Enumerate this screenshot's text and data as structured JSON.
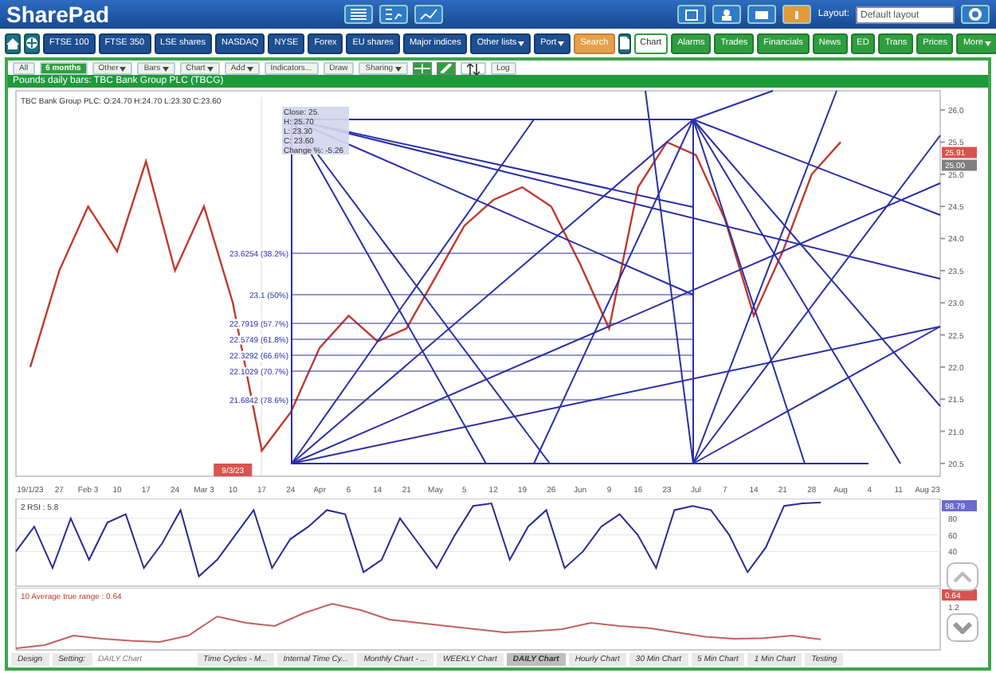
{
  "header": {
    "logo": "SharePad",
    "layout_label": "Layout:",
    "layout_value": "Default layout"
  },
  "nav": {
    "markets": [
      {
        "label": "FTSE 100",
        "dropdown": false
      },
      {
        "label": "FTSE 350",
        "dropdown": false
      },
      {
        "label": "LSE shares",
        "dropdown": false
      },
      {
        "label": "NASDAQ",
        "dropdown": false
      },
      {
        "label": "NYSE",
        "dropdown": false
      },
      {
        "label": "Forex",
        "dropdown": false
      },
      {
        "label": "EU shares",
        "dropdown": false
      },
      {
        "label": "Major indices",
        "dropdown": false
      },
      {
        "label": "Other lists",
        "dropdown": true
      },
      {
        "label": "Port",
        "dropdown": true
      }
    ],
    "search": "Search",
    "tools": [
      {
        "label": "Chart",
        "selected": true,
        "dropdown": false
      },
      {
        "label": "Alarms",
        "selected": false,
        "dropdown": false
      },
      {
        "label": "Trades",
        "selected": false,
        "dropdown": false
      },
      {
        "label": "Financials",
        "selected": false,
        "dropdown": false
      },
      {
        "label": "News",
        "selected": false,
        "dropdown": false
      },
      {
        "label": "ED",
        "selected": false,
        "dropdown": false
      },
      {
        "label": "Trans",
        "selected": false,
        "dropdown": false
      },
      {
        "label": "Prices",
        "selected": false,
        "dropdown": false
      },
      {
        "label": "More",
        "selected": false,
        "dropdown": true
      }
    ]
  },
  "toolbar": [
    {
      "label": "All",
      "selected": false,
      "dropdown": false
    },
    {
      "label": "6 months",
      "selected": true,
      "dropdown": false
    },
    {
      "label": "Other",
      "selected": false,
      "dropdown": true
    },
    {
      "label": "Bars",
      "selected": false,
      "dropdown": true
    },
    {
      "label": "Chart",
      "selected": false,
      "dropdown": true
    },
    {
      "label": "Add",
      "selected": false,
      "dropdown": true
    },
    {
      "label": "Indicators...",
      "selected": false,
      "dropdown": false
    },
    {
      "label": "Draw",
      "selected": false,
      "dropdown": false
    },
    {
      "label": "Sharing",
      "selected": false,
      "dropdown": true
    }
  ],
  "toolbar_log": "Log",
  "chart_title": "Pounds daily bars: TBC Bank Group PLC (TBCG)",
  "price_pane": {
    "legend": "TBC Bank Group PLC: O:24.70 H:24.70 L:23.30 C:23.60",
    "info_box": [
      "Close: 25.",
      "H: 25.70",
      "L: 23.30",
      "C: 23.60",
      "Change %: -5.26"
    ],
    "fib_labels": [
      "23.6254 (38.2%)",
      "23.1 (50%)",
      "22.7919 (57.7%)",
      "22.5749 (61.8%)",
      "22.3292 (66.6%)",
      "22.1029 (70.7%)",
      "21.6842 (78.6%)"
    ],
    "date_marker": "9/3/23",
    "price_badges": [
      {
        "text": "25.91",
        "color": "#d9534f"
      },
      {
        "text": "25.00",
        "color": "#808080"
      }
    ],
    "chart_data": {
      "type": "line",
      "categories": [
        "19/1/23",
        "27",
        "Feb 3",
        "10",
        "17",
        "24",
        "Mar 3",
        "10",
        "17",
        "24",
        "Apr",
        "6",
        "14",
        "21",
        "May",
        "5",
        "12",
        "19",
        "26",
        "Jun",
        "9",
        "16",
        "23",
        "Jul",
        "7",
        "14",
        "21",
        "28",
        "Aug",
        "4",
        "11",
        "Aug 23"
      ],
      "series": [
        {
          "color": "#c0392b",
          "values": [
            22.0,
            23.5,
            24.5,
            23.8,
            25.2,
            23.5,
            24.5,
            23.0,
            20.7,
            21.3,
            22.3,
            22.8,
            22.4,
            22.6,
            23.4,
            24.2,
            24.6,
            24.8,
            24.5,
            23.6,
            22.6,
            24.8,
            25.5,
            25.3,
            24.3,
            22.8,
            23.8,
            25.0,
            25.5,
            null,
            null,
            null
          ]
        }
      ],
      "ylim": [
        20.3,
        26.2
      ],
      "yticks": [
        {
          "value": 20.5,
          "label": "20.5"
        },
        {
          "value": 21,
          "label": "21.0"
        },
        {
          "value": 21.5,
          "label": "21.5"
        },
        {
          "value": 22,
          "label": "22.0"
        },
        {
          "value": 22.5,
          "label": "22.5"
        },
        {
          "value": 23,
          "label": "23.0"
        },
        {
          "value": 23.5,
          "label": "23.5"
        },
        {
          "value": 24,
          "label": "24.0"
        },
        {
          "value": 24.5,
          "label": "24.5"
        },
        {
          "value": 25,
          "label": "25.0"
        },
        {
          "value": 25.5,
          "label": "25.5"
        },
        {
          "value": 26,
          "label": "26.0"
        }
      ]
    }
  },
  "rsi_pane": {
    "legend": "2 RSI : 5.8",
    "badge": "98.79",
    "chart_data": {
      "type": "line",
      "series": [
        {
          "color": "#2a2a9a",
          "values": [
            40,
            70,
            20,
            80,
            30,
            75,
            85,
            20,
            50,
            90,
            10,
            30,
            60,
            90,
            20,
            55,
            70,
            90,
            85,
            15,
            30,
            80,
            50,
            20,
            60,
            95,
            98,
            30,
            70,
            90,
            20,
            40,
            70,
            85,
            60,
            20,
            90,
            95,
            90,
            60,
            15,
            45,
            95,
            98,
            99
          ]
        }
      ],
      "ylim": [
        0,
        100
      ],
      "yticks": [
        40,
        60,
        80
      ],
      "grid": true
    }
  },
  "atr_pane": {
    "legend": "10 Average true range : 0.64",
    "badge": "0.64",
    "scale_label": "1.2"
  },
  "footer": {
    "design": "Design",
    "setting_label": "Setting:",
    "setting_value": "DAILY Chart",
    "tabs": [
      {
        "label": "Time Cycles - M...",
        "selected": false
      },
      {
        "label": "Internal Time Cy...",
        "selected": false
      },
      {
        "label": "Monthly Chart - ...",
        "selected": false
      },
      {
        "label": "WEEKLY Chart",
        "selected": false
      },
      {
        "label": "DAILY Chart",
        "selected": true
      },
      {
        "label": "Hourly Chart",
        "selected": false
      },
      {
        "label": "30 Min Chart",
        "selected": false
      },
      {
        "label": "5 Min Chart",
        "selected": false
      },
      {
        "label": "1 Min Chart",
        "selected": false
      },
      {
        "label": "Testing",
        "selected": false
      }
    ]
  }
}
